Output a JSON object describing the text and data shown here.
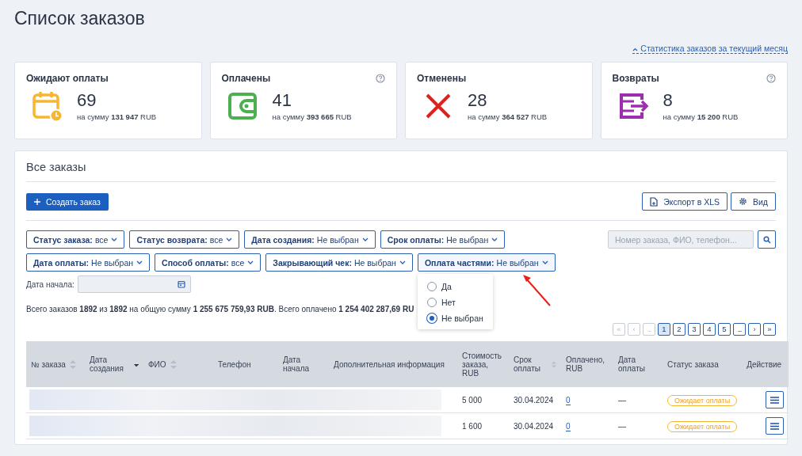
{
  "page_title": "Список заказов",
  "stats_link": "Статистика заказов за текущий месяц",
  "cards": [
    {
      "kind": "pending",
      "title": "Ожидают оплаты",
      "help": false,
      "count": "69",
      "sum_label": "на сумму",
      "sum": "131 947",
      "currency": "RUB"
    },
    {
      "kind": "paid",
      "title": "Оплачены",
      "help": true,
      "count": "41",
      "sum_label": "на сумму",
      "sum": "393 665",
      "currency": "RUB"
    },
    {
      "kind": "cancelled",
      "title": "Отменены",
      "help": false,
      "count": "28",
      "sum_label": "на сумму",
      "sum": "364 527",
      "currency": "RUB"
    },
    {
      "kind": "returns",
      "title": "Возвраты",
      "help": true,
      "count": "8",
      "sum_label": "на сумму",
      "sum": "15 200",
      "currency": "RUB"
    }
  ],
  "panel": {
    "title": "Все заказы",
    "create_button": "Создать заказ",
    "export_button": "Экспорт в XLS",
    "view_button": "Вид",
    "filter_rows": [
      [
        {
          "label": "Статус заказа:",
          "value": "все",
          "expanded": false
        },
        {
          "label": "Статус возврата:",
          "value": "все",
          "expanded": false
        },
        {
          "label": "Дата создания:",
          "value": "Не выбран",
          "expanded": false
        },
        {
          "label": "Срок оплаты:",
          "value": "Не выбран",
          "expanded": false
        }
      ],
      [
        {
          "label": "Дата оплаты:",
          "value": "Не выбран",
          "expanded": false
        },
        {
          "label": "Способ оплаты:",
          "value": "все",
          "expanded": false
        },
        {
          "label": "Закрывающий чек:",
          "value": "Не выбран",
          "expanded": false
        },
        {
          "label": "Оплата частями:",
          "value": "Не выбран",
          "expanded": true,
          "options": [
            {
              "label": "Да",
              "selected": false
            },
            {
              "label": "Нет",
              "selected": false
            },
            {
              "label": "Не выбран",
              "selected": true
            }
          ]
        }
      ]
    ],
    "search": {
      "placeholder": "Номер заказа, ФИО, телефон..."
    },
    "start_date": {
      "label": "Дата начала:"
    },
    "summary": "Всего заказов **1892** из **1892** на общую сумму **1 255 675 759,93 RUB**. Всего оплачено **1 254 402 287,69 RU**",
    "pagination": [
      {
        "kind": "first",
        "text": "«",
        "selected": false,
        "disabled": true
      },
      {
        "kind": "prev",
        "text": "‹",
        "selected": false,
        "disabled": true
      },
      {
        "kind": "gap",
        "text": "...",
        "selected": false,
        "disabled": true
      },
      {
        "kind": "page",
        "text": "1",
        "selected": true,
        "disabled": false
      },
      {
        "kind": "page",
        "text": "2",
        "selected": false,
        "disabled": false
      },
      {
        "kind": "page",
        "text": "3",
        "selected": false,
        "disabled": false
      },
      {
        "kind": "page",
        "text": "4",
        "selected": false,
        "disabled": false
      },
      {
        "kind": "page",
        "text": "5",
        "selected": false,
        "disabled": false
      },
      {
        "kind": "gap",
        "text": "...",
        "selected": false,
        "disabled": false
      },
      {
        "kind": "next",
        "text": "›",
        "selected": false,
        "disabled": false
      },
      {
        "kind": "last",
        "text": "»",
        "selected": false,
        "disabled": false
      }
    ],
    "table": {
      "columns": [
        {
          "label": "№ заказа",
          "sortable": true,
          "sorted_desc": false
        },
        {
          "label": "Дата создания",
          "sortable": true,
          "sorted_desc": true
        },
        {
          "label": "ФИО",
          "sortable": true,
          "sorted_desc": false
        },
        {
          "label": "Телефон"
        },
        {
          "label": "Дата начала"
        },
        {
          "label": "Дополнительная информация"
        },
        {
          "label": "Стоимость заказа, RUB"
        },
        {
          "label": "Срок оплаты",
          "sortable": true,
          "sorted_desc": false
        },
        {
          "label": "Оплачено, RUB"
        },
        {
          "label": "Дата оплаты"
        },
        {
          "label": "Статус заказа"
        },
        {
          "label": "Действие"
        }
      ],
      "rows": [
        {
          "redacted": true,
          "cost": "5 000",
          "due": "30.04.2024",
          "paid": "0",
          "paid_date": "—",
          "status": "Ожидает оплаты"
        },
        {
          "redacted": true,
          "cost": "1 600",
          "due": "30.04.2024",
          "paid": "0",
          "paid_date": "—",
          "status": "Ожидает оплаты"
        }
      ]
    }
  },
  "annotation": {
    "kind": "arrow"
  }
}
